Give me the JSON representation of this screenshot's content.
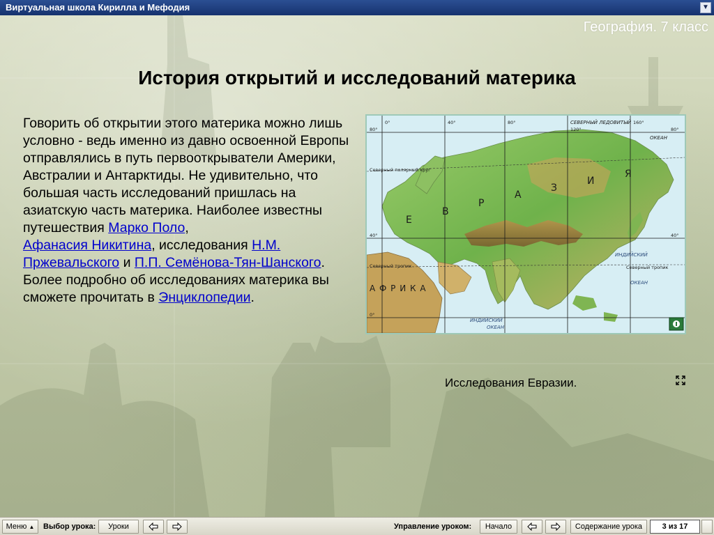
{
  "window": {
    "title": "Виртуальная школа Кирилла и Мефодия"
  },
  "page": {
    "subject": "География. 7 класс",
    "heading": "История открытий и исследований материка",
    "paragraph_1": "Говорить об открытии этого материка можно лишь условно - ведь именно из давно освоенной Европы отправлялись в путь первооткрыватели Америки, Австралии и Антарктиды. Не удивительно, что большая часть исследований пришлась на азиатскую часть материка. Наиболее известны путешествия ",
    "link_marco_polo": "Марко Поло",
    "sep_1": ",",
    "link_nikitin": "Афанасия Никитина",
    "sep_2": ", исследования ",
    "link_przhevalsky": "Н.М. Пржевальского",
    "sep_3": " и ",
    "link_semenov": "П.П. Семёнова-Тян-Шанского",
    "sep_4": ".",
    "paragraph_2": "Более подробно об исследованиях материка вы сможете прочитать в ",
    "link_encyclopedia": "Энциклопедии",
    "sep_5": "."
  },
  "map": {
    "caption": "Исследования Евразии.",
    "labels": {
      "north_ocean_1": "СЕВЕРНЫЙ ЛЕДОВИТЫЙ",
      "north_ocean_2": "ОКЕАН",
      "polar_circle": "Северный полярный круг",
      "tropic_left": "Северный тропик",
      "tropic_right": "Северный тропик",
      "indian_ocean_1": "ИНДИЙСКИЙ",
      "indian_ocean_2": "ОКЕАН",
      "indian_ocean_3": "ИНДИЙСКИЙ",
      "indian_ocean_4": "ОКЕАН",
      "africa": "А Ф Р И К А",
      "eurasia": [
        "Е",
        "В",
        "Р",
        "А",
        "З",
        "И",
        "Я"
      ],
      "lon_0": "0°",
      "lon_40": "40°",
      "lon_80": "80°",
      "lon_120": "120°",
      "lon_160": "160°",
      "lat_80_left": "80°",
      "lat_80_right": "80°",
      "lat_40_left": "40°",
      "lat_40_right": "40°",
      "lat_0": "0°"
    }
  },
  "toolbar": {
    "menu_label": "Меню",
    "lesson_select_label": "Выбор урока:",
    "lessons_button": "Уроки",
    "lesson_control_label": "Управление уроком:",
    "start_button": "Начало",
    "contents_button": "Содержание урока",
    "page_counter": "3 из 17"
  },
  "colors": {
    "titlebar": "#1e3c80",
    "link": "#0000cc",
    "subject_text": "#ffffff",
    "map_border": "#9ec9b8"
  }
}
